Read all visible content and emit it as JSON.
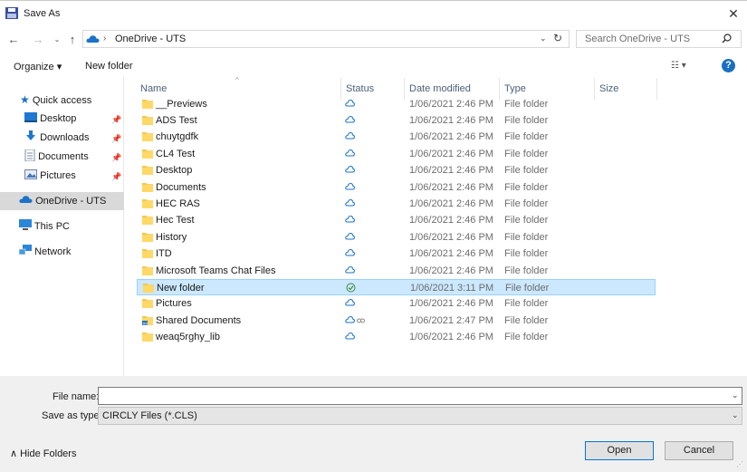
{
  "window": {
    "title": "Save As",
    "close_glyph": "✕",
    "icon": "save-as-icon"
  },
  "nav": {
    "back": "←",
    "forward": "→",
    "recent": "⌄",
    "up": "↑",
    "address_text": "OneDrive - UTS",
    "address_separator": "›",
    "address_dropdown": "⌄",
    "refresh": "↻",
    "search_placeholder": "Search OneDrive - UTS"
  },
  "toolbar": {
    "organize": "Organize ▾",
    "new_folder": "New folder",
    "view": "☷ ▾",
    "help": "?"
  },
  "sidebar": {
    "items": [
      {
        "label": "Quick access",
        "icon": "star-icon"
      },
      {
        "label": "Desktop",
        "icon": "desktop-icon",
        "pinned": true
      },
      {
        "label": "Downloads",
        "icon": "download-arrow-icon",
        "pinned": true
      },
      {
        "label": "Documents",
        "icon": "document-icon",
        "pinned": true
      },
      {
        "label": "Pictures",
        "icon": "pictures-icon",
        "pinned": true
      },
      {
        "label": "OneDrive - UTS",
        "icon": "cloud-icon",
        "selected": true
      },
      {
        "label": "This PC",
        "icon": "monitor-icon"
      },
      {
        "label": "Network",
        "icon": "network-icon"
      }
    ],
    "pin_glyph": "📌"
  },
  "columns": {
    "name": "Name",
    "status": "Status",
    "date": "Date modified",
    "type": "Type",
    "size": "Size",
    "sort_arrow": "^"
  },
  "files": [
    {
      "name": "__Previews",
      "status": "cloud",
      "date": "1/06/2021 2:46 PM",
      "type": "File folder"
    },
    {
      "name": "ADS Test",
      "status": "cloud",
      "date": "1/06/2021 2:46 PM",
      "type": "File folder"
    },
    {
      "name": "chuytgdfk",
      "status": "cloud",
      "date": "1/06/2021 2:46 PM",
      "type": "File folder"
    },
    {
      "name": "CL4 Test",
      "status": "cloud",
      "date": "1/06/2021 2:46 PM",
      "type": "File folder"
    },
    {
      "name": "Desktop",
      "status": "cloud",
      "date": "1/06/2021 2:46 PM",
      "type": "File folder"
    },
    {
      "name": "Documents",
      "status": "cloud",
      "date": "1/06/2021 2:46 PM",
      "type": "File folder"
    },
    {
      "name": "HEC RAS",
      "status": "cloud",
      "date": "1/06/2021 2:46 PM",
      "type": "File folder"
    },
    {
      "name": "Hec Test",
      "status": "cloud",
      "date": "1/06/2021 2:46 PM",
      "type": "File folder"
    },
    {
      "name": "History",
      "status": "cloud",
      "date": "1/06/2021 2:46 PM",
      "type": "File folder"
    },
    {
      "name": "ITD",
      "status": "cloud",
      "date": "1/06/2021 2:46 PM",
      "type": "File folder"
    },
    {
      "name": "Microsoft Teams Chat Files",
      "status": "cloud",
      "date": "1/06/2021 2:46 PM",
      "type": "File folder"
    },
    {
      "name": "New folder",
      "status": "synced",
      "date": "1/06/2021 3:11 PM",
      "type": "File folder",
      "selected": true
    },
    {
      "name": "Pictures",
      "status": "cloud",
      "date": "1/06/2021 2:46 PM",
      "type": "File folder"
    },
    {
      "name": "Shared Documents",
      "status": "cloud-shared",
      "date": "1/06/2021 2:47 PM",
      "type": "File folder",
      "shared": true
    },
    {
      "name": "weaq5rghy_lib",
      "status": "cloud",
      "date": "1/06/2021 2:46 PM",
      "type": "File folder"
    }
  ],
  "bottom": {
    "file_name_label": "File name:",
    "file_name_value": "",
    "save_type_label": "Save as type:",
    "save_type_value": "CIRCLY Files (*.CLS)",
    "dropdown_glyph": "⌄",
    "hide_folders": "∧  Hide Folders",
    "open": "Open",
    "cancel": "Cancel",
    "grip": "⋰"
  },
  "colors": {
    "accent": "#0078d7",
    "cloud": "#1a73c8",
    "synced": "#3c8a3c",
    "folder": "#f5c84c",
    "selected_row": "#cce8ff"
  }
}
